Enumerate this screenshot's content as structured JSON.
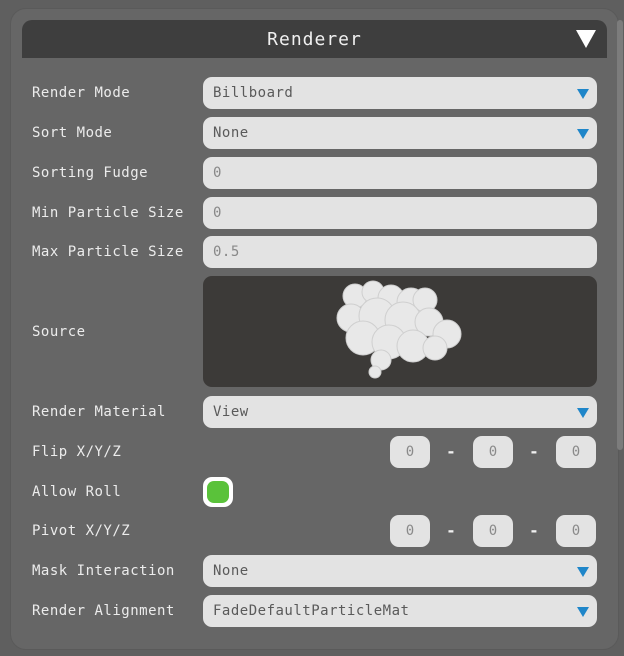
{
  "panel": {
    "title": "Renderer"
  },
  "fields": {
    "render_mode": {
      "label": "Render Mode",
      "value": "Billboard"
    },
    "sort_mode": {
      "label": "Sort Mode",
      "value": "None"
    },
    "sorting_fudge": {
      "label": "Sorting Fudge",
      "value": "0"
    },
    "min_particle_size": {
      "label": "Min Particle Size",
      "value": "0"
    },
    "max_particle_size": {
      "label": "Max Particle Size",
      "value": "0.5"
    },
    "source": {
      "label": "Source"
    },
    "render_material": {
      "label": "Render Material",
      "value": "View"
    },
    "flip_xyz": {
      "label": "Flip X/Y/Z",
      "x": "0",
      "y": "0",
      "z": "0",
      "separator": "-"
    },
    "allow_roll": {
      "label": "Allow Roll",
      "checked": true
    },
    "pivot_xyz": {
      "label": "Pivot X/Y/Z",
      "x": "0",
      "y": "0",
      "z": "0",
      "separator": "-"
    },
    "mask_interaction": {
      "label": "Mask Interaction",
      "value": "None"
    },
    "render_alignment": {
      "label": "Render Alignment",
      "value": "FadeDefaultParticleMat"
    }
  },
  "icons": {
    "collapse": "triangle-down-icon",
    "dropdown": "dropdown-arrow-icon",
    "source_preview": "smoke-particle-icon"
  },
  "colors": {
    "panel_bg": "#666666",
    "header_bg": "#3e3e3e",
    "field_bg": "#e3e3e3",
    "dropdown_arrow": "#1f86c9",
    "toggle_on": "#5ac23a",
    "source_bg": "#3c3a38"
  }
}
